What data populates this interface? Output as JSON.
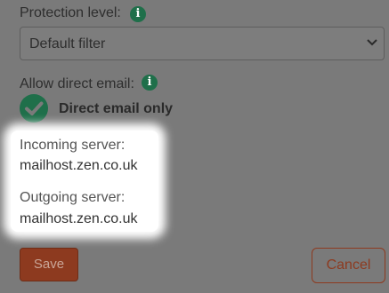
{
  "protection": {
    "label": "Protection level:",
    "info_icon_glyph": "i",
    "info_icon": "info-icon",
    "selected": "Default filter"
  },
  "direct_email": {
    "label": "Allow direct email:",
    "info_icon_glyph": "i",
    "info_icon": "info-icon",
    "status_icon": "check-circle-icon",
    "status_text": "Direct email only"
  },
  "servers": {
    "incoming_label": "Incoming server:",
    "incoming_value": "mailhost.zen.co.uk",
    "outgoing_label": "Outgoing server:",
    "outgoing_value": "mailhost.zen.co.uk"
  },
  "actions": {
    "save_label": "Save",
    "cancel_label": "Cancel"
  },
  "colors": {
    "accent_green": "#1f6f4a",
    "brand_red": "#8d3a1f",
    "overlay_gray": "#7a7a7a"
  }
}
